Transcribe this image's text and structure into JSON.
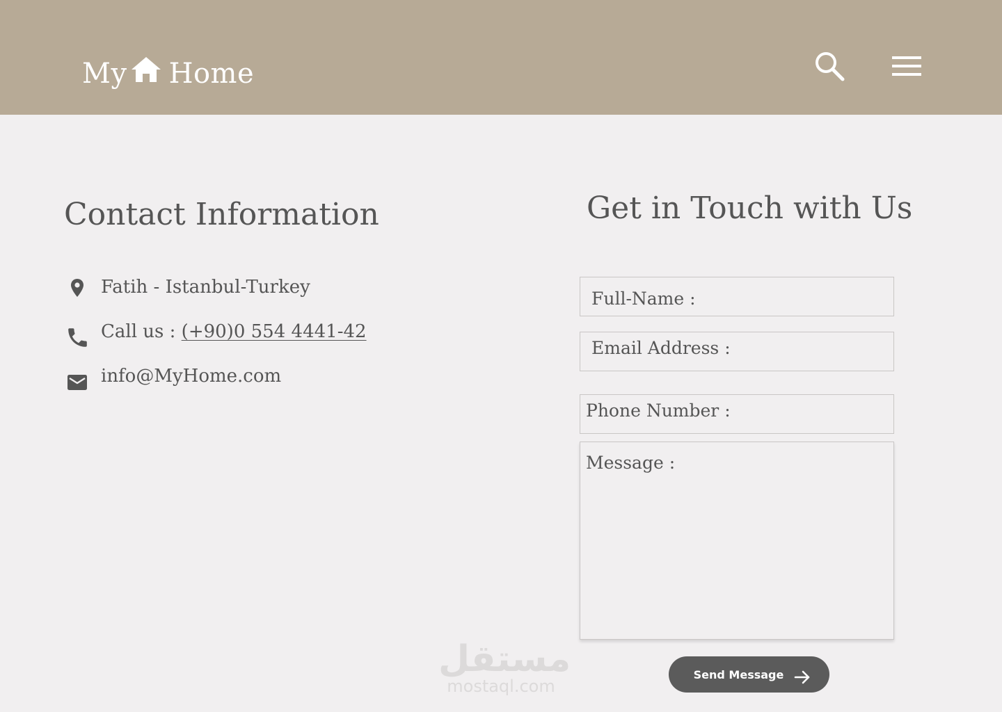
{
  "header": {
    "logo_left": "My",
    "logo_right": "Home",
    "search_icon": "search-icon",
    "menu_icon": "hamburger-menu-icon",
    "background": "#b7aa96"
  },
  "contact": {
    "title": "Contact Information",
    "location": "Fatih - Istanbul-Turkey",
    "phone_prefix": "Call us : ",
    "phone_number": "(+90)0 554 4441-42",
    "email": "info@MyHome.com"
  },
  "form": {
    "title": "Get in Touch with Us",
    "fullname_placeholder": "Full-Name :",
    "email_placeholder": "Email Address :",
    "phone_placeholder": "Phone Number :",
    "message_placeholder": "Message :",
    "submit_label": "Send Message",
    "submit_icon": "arrow-right-icon",
    "button_color": "#5b5b5b"
  },
  "watermark": {
    "arabic": "مستقل",
    "latin": "mostaql.com"
  }
}
